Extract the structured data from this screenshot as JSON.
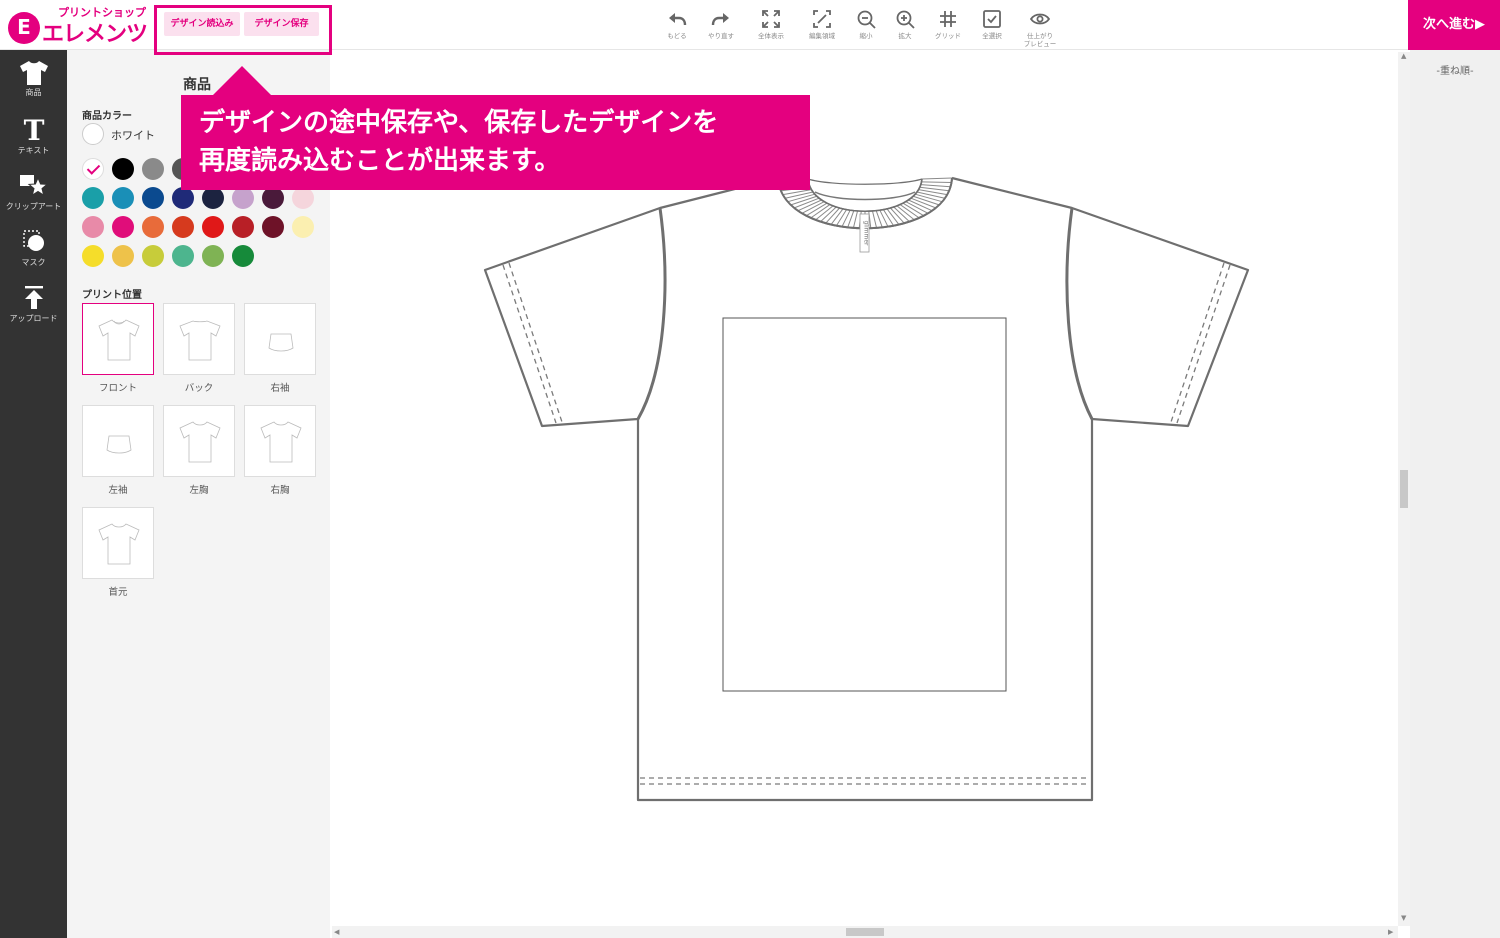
{
  "header": {
    "logo_small": "プリントショップ",
    "logo_big": "エレメンツ",
    "logo_mark": "E",
    "load_design": "デザイン読込み",
    "save_design": "デザイン保存",
    "next": "次へ進む▶"
  },
  "tools": [
    {
      "label": "もどる",
      "icon": "undo-icon"
    },
    {
      "label": "やり直す",
      "icon": "redo-icon"
    },
    {
      "label": "全体表示",
      "icon": "fit-view-icon"
    },
    {
      "label": "編集領域",
      "icon": "edit-area-icon"
    },
    {
      "label": "縮小",
      "icon": "zoom-out-icon"
    },
    {
      "label": "拡大",
      "icon": "zoom-in-icon"
    },
    {
      "label": "グリッド",
      "icon": "grid-icon"
    },
    {
      "label": "全選択",
      "icon": "select-all-icon"
    },
    {
      "label": "仕上がり\nプレビュー",
      "icon": "preview-eye-icon"
    }
  ],
  "toolbar": [
    {
      "label": "商品",
      "icon": "tshirt-icon"
    },
    {
      "label": "テキスト",
      "icon": "text-icon"
    },
    {
      "label": "クリップアート",
      "icon": "clipart-icon"
    },
    {
      "label": "マスク",
      "icon": "mask-icon"
    },
    {
      "label": "アップロード",
      "icon": "upload-icon"
    }
  ],
  "panel": {
    "title": "商品",
    "color_section": "商品カラー",
    "selected_color": "ホワイト",
    "swatches": [
      "#ffffff",
      "#000000",
      "#8a8a8a",
      "#555555",
      "#333333",
      "#6b5b45",
      "#eeeeee",
      "#f3dada",
      "#1a9fa8",
      "#1a8fb7",
      "#0b4a8f",
      "#1f2a78",
      "#1c2340",
      "#c6a2cc",
      "#4a1a3a",
      "#f5d5dc",
      "#e88aa8",
      "#e00d7a",
      "#e86b3a",
      "#d63a1e",
      "#e01818",
      "#b81f26",
      "#6e1228",
      "#fbefb0",
      "#f5dd2a",
      "#eec24a",
      "#c7cc3a",
      "#4db58e",
      "#7fb354",
      "#168a3a"
    ],
    "print_section": "プリント位置",
    "positions": [
      "フロント",
      "バック",
      "右袖",
      "左袖",
      "左胸",
      "右胸",
      "首元"
    ]
  },
  "callout": {
    "line1": "デザインの途中保存や、保存したデザインを",
    "line2": "再度読み込むことが出来ます。"
  },
  "canvas": {
    "tag_text": "glimmer"
  },
  "layers": {
    "title": "-重ね順-"
  },
  "colors": {
    "accent": "#e4007f",
    "toolbar_bg": "#333333",
    "panel_bg": "#f4f4f4"
  }
}
